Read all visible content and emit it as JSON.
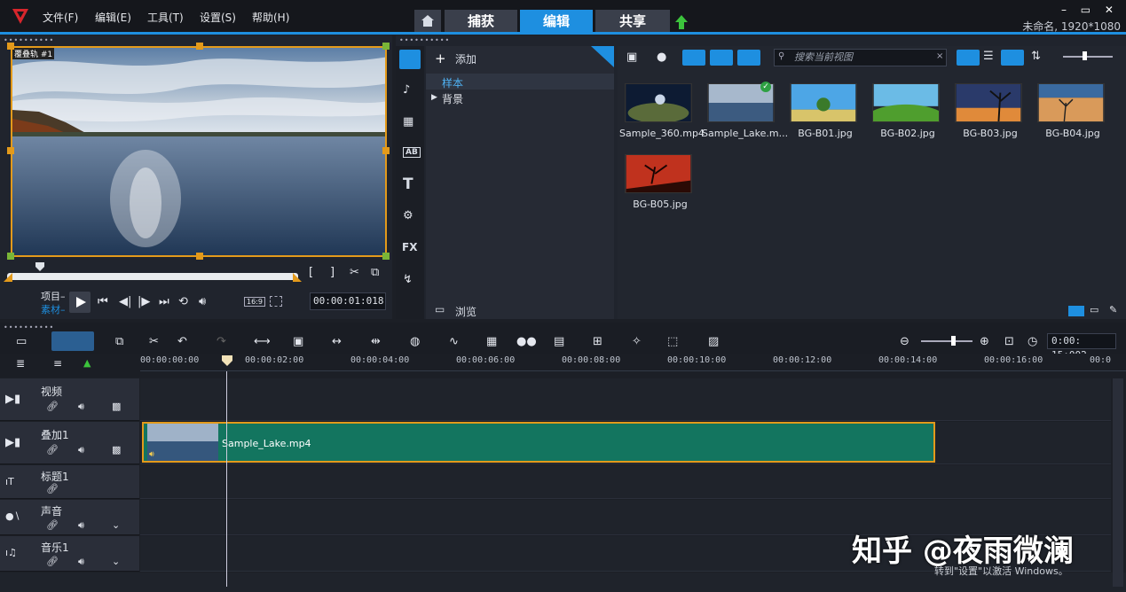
{
  "menu": {
    "file": "文件(F)",
    "edit": "编辑(E)",
    "tools": "工具(T)",
    "settings": "设置(S)",
    "help": "帮助(H)"
  },
  "tabs": {
    "capture": "捕获",
    "edit": "编辑",
    "share": "共享"
  },
  "window": {
    "controls": "–  ▭  ✕",
    "project_info": "未命名, 1920*1080"
  },
  "preview": {
    "overlay_label": "覆叠轨 #1",
    "mode_project": "项目–",
    "mode_clip": "素材–",
    "aspect": "16:9",
    "timecode": "00:00:01:018",
    "scrubber_position": 0.11
  },
  "library": {
    "add_label": "添加",
    "tree": {
      "samples": "样本",
      "backgrounds": "背景"
    },
    "browse_label": "浏览",
    "search_placeholder": "搜索当前视图",
    "items": [
      {
        "name": "Sample_360.mp4"
      },
      {
        "name": "Sample_Lake.m..."
      },
      {
        "name": "BG-B01.jpg"
      },
      {
        "name": "BG-B02.jpg"
      },
      {
        "name": "BG-B03.jpg"
      },
      {
        "name": "BG-B04.jpg"
      },
      {
        "name": "BG-B05.jpg"
      }
    ],
    "fx_label": "FX"
  },
  "timeline": {
    "zoom_timecode": "0:00: 15:002",
    "ruler": [
      "00:00:00:00",
      "00:00:02:00",
      "00:00:04:00",
      "00:00:06:00",
      "00:00:08:00",
      "00:00:10:00",
      "00:00:12:00",
      "00:00:14:00",
      "00:00:16:00",
      "00:0"
    ],
    "tracks": {
      "video": "视频",
      "overlay": "叠加1",
      "title": "标题1",
      "voice": "声音",
      "music": "音乐1"
    },
    "clip_name": "Sample_Lake.mp4"
  },
  "overlay_text": {
    "watermark": "知乎 @夜雨微澜",
    "activate": "转到\"设置\"以激活 Windows。"
  },
  "colors": {
    "accent": "#1e8fe0",
    "clip": "#13755f",
    "selection": "#e39a1b"
  }
}
